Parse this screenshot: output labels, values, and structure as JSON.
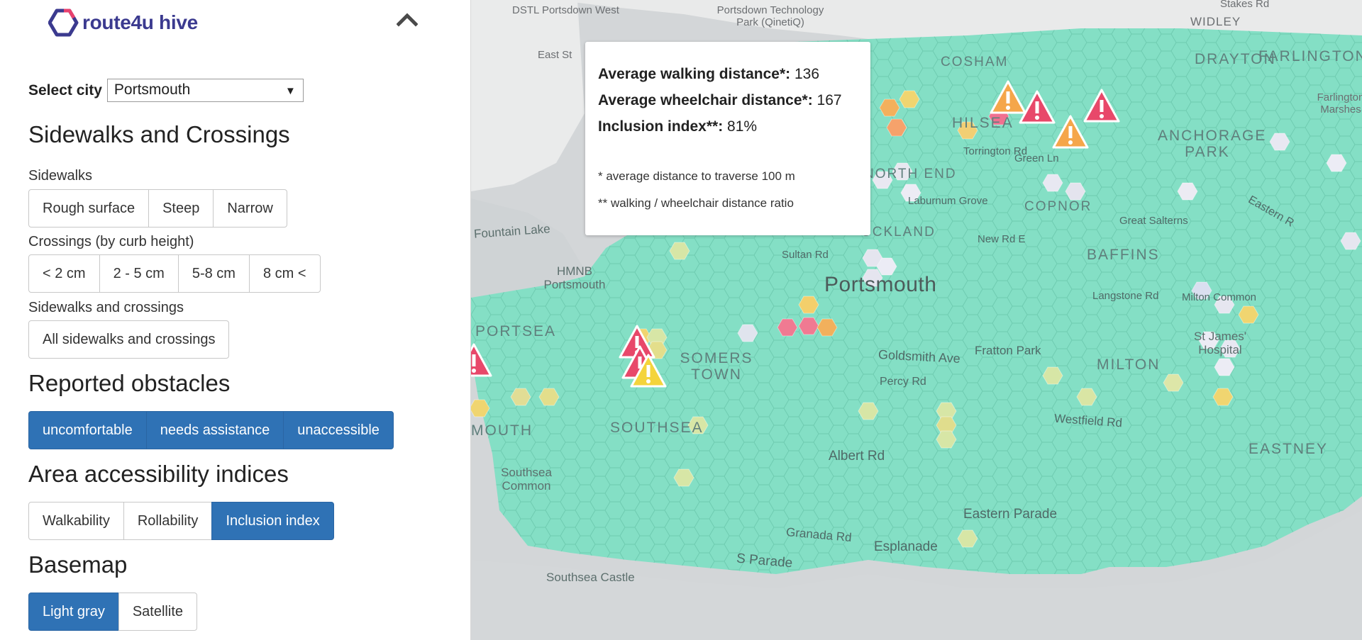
{
  "app": {
    "logo_text": "route4u hive"
  },
  "city": {
    "label": "Select city",
    "selected": "Portsmouth"
  },
  "sections": {
    "sidewalks_crossings": "Sidewalks and Crossings",
    "reported_obstacles": "Reported obstacles",
    "indices": "Area accessibility indices",
    "basemap": "Basemap"
  },
  "sidewalks": {
    "label": "Sidewalks",
    "buttons": [
      "Rough surface",
      "Steep",
      "Narrow"
    ]
  },
  "crossings": {
    "label": "Crossings (by curb height)",
    "buttons": [
      "< 2 cm",
      "2 - 5 cm",
      "5-8 cm",
      "8 cm <"
    ]
  },
  "combined": {
    "label": "Sidewalks and crossings",
    "buttons": [
      "All sidewalks and crossings"
    ]
  },
  "obstacles": {
    "buttons": [
      "uncomfortable",
      "needs assistance",
      "unaccessible"
    ]
  },
  "indices": {
    "buttons": [
      "Walkability",
      "Rollability",
      "Inclusion index"
    ],
    "active": "Inclusion index"
  },
  "basemap": {
    "buttons": [
      "Light gray",
      "Satellite"
    ],
    "active": "Light gray"
  },
  "tooltip": {
    "walk_label": "Average walking distance*:",
    "walk_value": "136",
    "wheel_label": "Average wheelchair distance*:",
    "wheel_value": "167",
    "incl_label": "Inclusion index**:",
    "incl_value": "81%",
    "note1": "* average distance to traverse 100 m",
    "note2": "** walking / wheelchair distance ratio"
  },
  "map_labels": {
    "dstl": "DSTL Portsdown West",
    "tech": "Portsdown Technology Park (QinetiQ)",
    "widley": "WIDLEY",
    "drayton": "DRAYTON",
    "farlington": "FARLINGTON",
    "farlington_marshes": "Farlington Marshes",
    "cosham": "COSHAM",
    "hilsea": "HILSEA",
    "anchorage": "ANCHORAGE PARK",
    "north_end": "NORTH END",
    "copnor": "COPNOR",
    "baffins": "BAFFINS",
    "portsmouth": "Portsmouth",
    "hmnb": "HMNB Portsmouth",
    "portsea": "PORTSEA",
    "somers": "SOMERS TOWN",
    "southsea": "SOUTHSEA",
    "milton": "MILTON",
    "eastney": "EASTNEY",
    "east_st": "East St",
    "fountain_lake": "Fountain Lake",
    "ckland": "UCKLAND",
    "sultan": "Sultan Rd",
    "new_rd": "New Rd E",
    "laburnum": "Laburnum Grove",
    "torrington": "Torrington Rd",
    "green_ln": "Green Ln",
    "great_salterns": "Great Salterns",
    "langstone": "Langstone Rd",
    "milton_common": "Milton Common",
    "st_james": "St James' Hospital",
    "fratton": "Fratton Park",
    "goldsmith": "Goldsmith Ave",
    "percy": "Percy Rd",
    "westfield": "Westfield Rd",
    "albert": "Albert Rd",
    "southsea_common": "Southsea Common",
    "eastern_parade": "Eastern Parade",
    "granada": "Granada Rd",
    "esplanade": "Esplanade",
    "s_parade": "S Parade",
    "southsea_castle": "Southsea Castle",
    "eastern_rd": "Eastern R",
    "stakes": "Stakes Rd",
    "mouth": "MOUTH"
  },
  "colors": {
    "accent": "#2f72b5",
    "hex_base": "#84dfc5",
    "warning_red": "#e8486a",
    "warning_orange": "#f5a64a",
    "warning_yellow": "#f4d43c"
  },
  "icons": {
    "collapse": "chevron-up-icon",
    "logo": "hexagon-logo-icon",
    "obstacle": "warning-triangle-icon"
  }
}
